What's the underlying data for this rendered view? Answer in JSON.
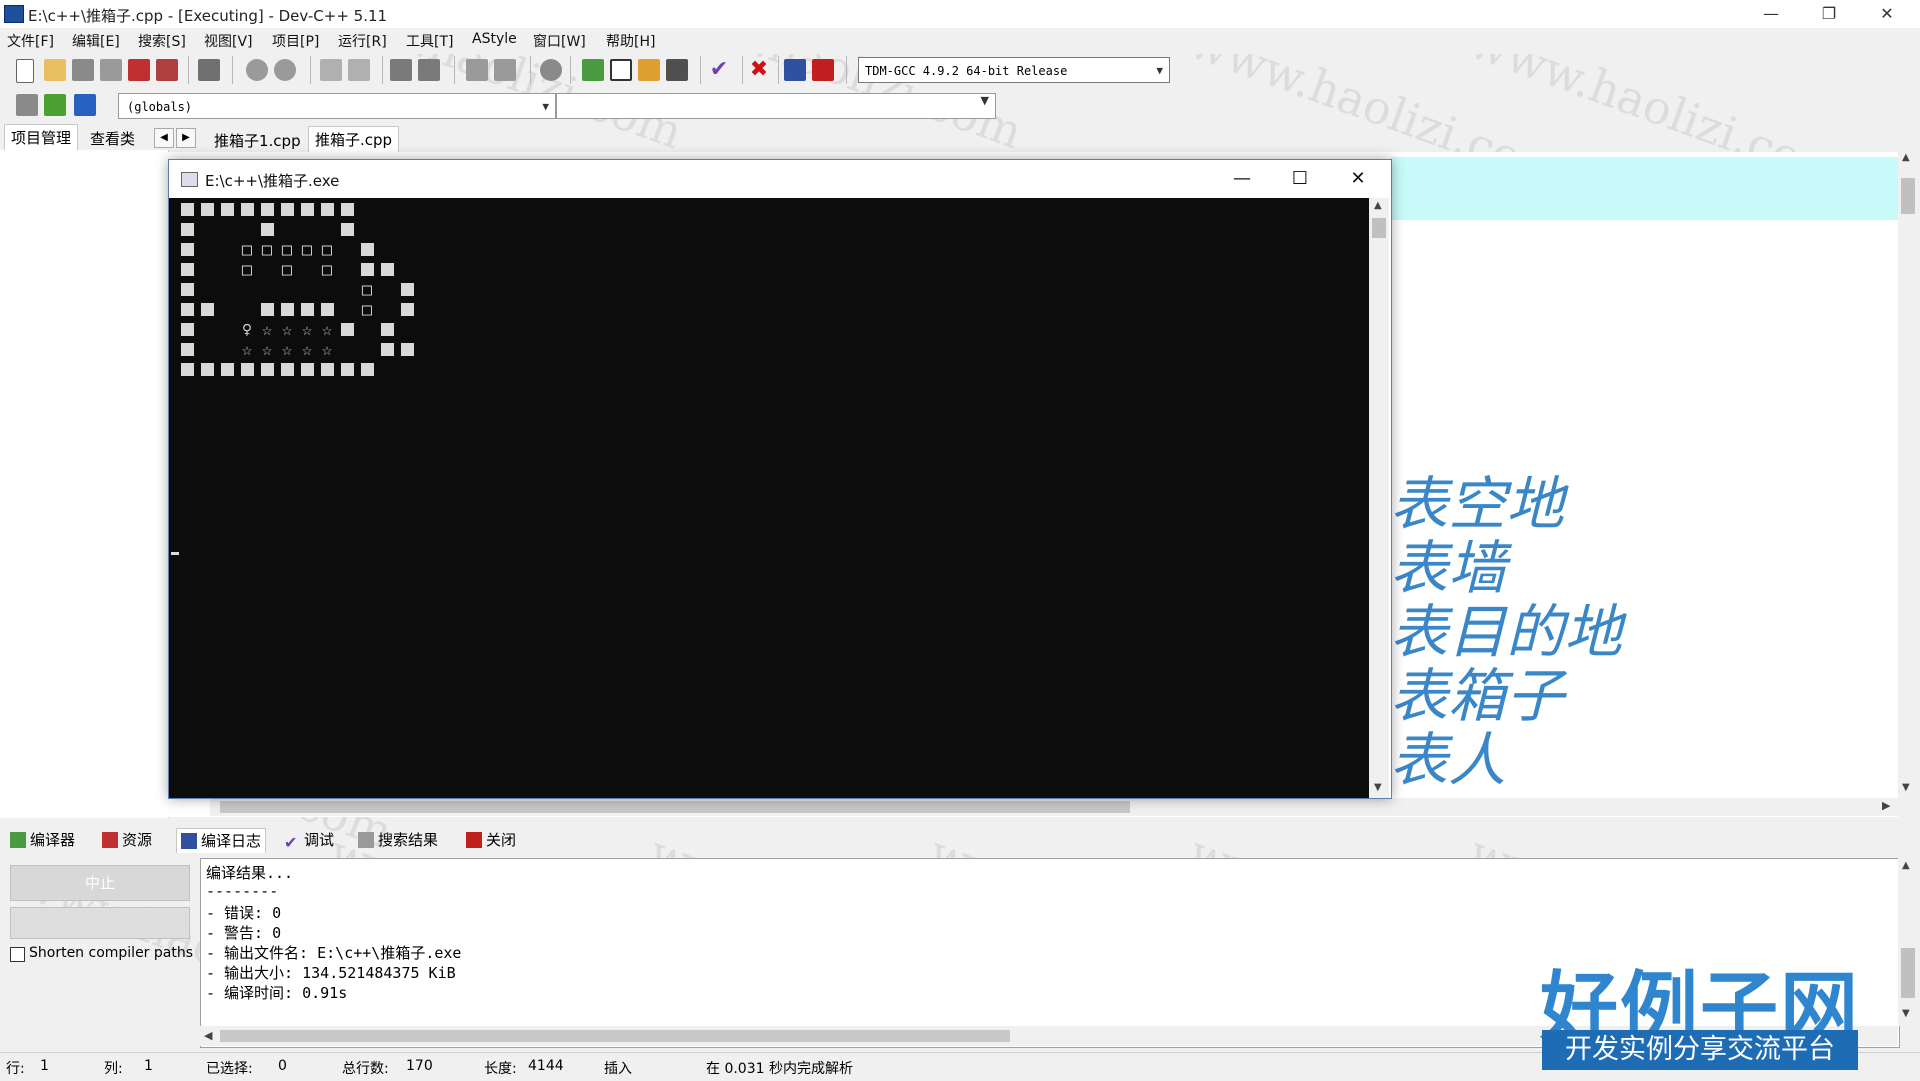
{
  "window": {
    "title": "E:\\c++\\推箱子.cpp - [Executing] - Dev-C++ 5.11",
    "minimize": "—",
    "restore": "❐",
    "close": "✕"
  },
  "menu": [
    "文件[F]",
    "编辑[E]",
    "搜索[S]",
    "视图[V]",
    "项目[P]",
    "运行[R]",
    "工具[T]",
    "AStyle",
    "窗口[W]",
    "帮助[H]"
  ],
  "toolbar": {
    "compiler": "TDM-GCC 4.9.2 64-bit Release",
    "scope": "(globals)"
  },
  "left_tabs": [
    "项目管理",
    "查看类"
  ],
  "editor_tabs": [
    "推箱子1.cpp",
    "推箱子.cpp"
  ],
  "editor_comments": [
    "表空地",
    "表墙",
    "表目的地",
    "表箱子",
    "表人"
  ],
  "console": {
    "title": "E:\\c++\\推箱子.exe",
    "minimize": "—",
    "maximize": "☐",
    "close": "✕",
    "board": [
      "XXXXXXXXX",
      "X   X   X",
      "X  OOOOO X",
      "X  O O O XX",
      "X        O X",
      "XX  XXXX O X",
      "X  ♀☆☆☆☆X X",
      "X  ☆☆☆☆☆  XX",
      "XXXXXXXXXX"
    ]
  },
  "bottom_tabs": [
    "编译器",
    "资源",
    "编译日志",
    "调试",
    "搜索结果",
    "关闭"
  ],
  "log_panel": {
    "stop_label": "中止",
    "shorten_label": "Shorten compiler paths",
    "lines": [
      "编译结果...",
      "--------",
      "- 错误: 0",
      "- 警告: 0",
      "- 输出文件名: E:\\c++\\推箱子.exe",
      "- 输出大小: 134.521484375 KiB",
      "- 编译时间: 0.91s"
    ]
  },
  "status": {
    "row_label": "行:",
    "row": "1",
    "col_label": "列:",
    "col": "1",
    "sel_label": "已选择:",
    "sel": "0",
    "lines_label": "总行数:",
    "lines": "170",
    "len_label": "长度:",
    "len": "4144",
    "mode": "插入",
    "parse": "在 0.031 秒内完成解析"
  },
  "watermark": "www.haolizi.com",
  "logo": {
    "main": "好例子网",
    "sub": "开发实例分享交流平台"
  }
}
